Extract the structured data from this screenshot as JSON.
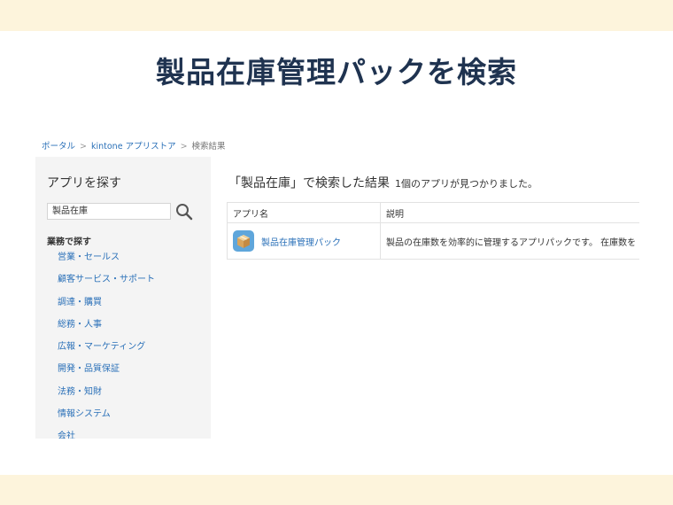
{
  "slide": {
    "title": "製品在庫管理パックを検索"
  },
  "breadcrumb": {
    "portal": "ポータル",
    "separator": ">",
    "store": "kintone アプリストア",
    "current": "検索結果"
  },
  "sidebar": {
    "heading": "アプリを探す",
    "search_value": "製品在庫",
    "category_heading": "業務で探す",
    "categories": [
      "営業・セールス",
      "顧客サービス・サポート",
      "調達・購買",
      "総務・人事",
      "広報・マーケティング",
      "開発・品質保証",
      "法務・知財",
      "情報システム",
      "会社"
    ]
  },
  "results": {
    "heading": "「製品在庫」で検索した結果",
    "count_text": "1個のアプリが見つかりました。",
    "columns": [
      "アプリ名",
      "説明"
    ],
    "rows": [
      {
        "name": "製品在庫管理パック",
        "description": "製品の在庫数を効率的に管理するアプリパックです。 在庫数を"
      }
    ]
  },
  "colors": {
    "band": "#fdf4dc",
    "title": "#1f3350",
    "link": "#2a70b8",
    "sidebar_bg": "#f4f4f4"
  }
}
